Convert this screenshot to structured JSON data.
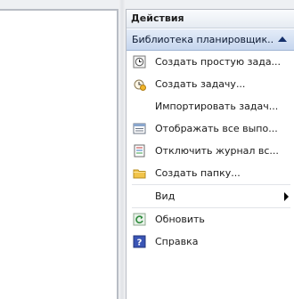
{
  "actions_pane": {
    "title": "Действия",
    "section": {
      "title": "Библиотека планировщик...",
      "expanded": true
    },
    "items": [
      {
        "label": "Создать простую зада...",
        "icon": "create-basic-task-icon"
      },
      {
        "label": "Создать задачу...",
        "icon": "create-task-icon"
      },
      {
        "label": "Импортировать задач...",
        "icon": ""
      },
      {
        "label": "Отображать все выпо...",
        "icon": "display-running-tasks-icon"
      },
      {
        "label": "Отключить журнал вс...",
        "icon": "history-log-icon"
      },
      {
        "label": "Создать папку...",
        "icon": "new-folder-icon"
      },
      {
        "label": "Вид",
        "icon": "",
        "submenu": true
      },
      {
        "label": "Обновить",
        "icon": "refresh-icon"
      },
      {
        "label": "Справка",
        "icon": "help-icon"
      }
    ]
  },
  "colors": {
    "header_bg": "#e6ebf2",
    "section_bg": "#c6d6ee",
    "section_arrow": "#15306b",
    "help_icon": "#3a55b5",
    "refresh_icon": "#2e8b3c",
    "folder_icon": "#f2c44a"
  }
}
